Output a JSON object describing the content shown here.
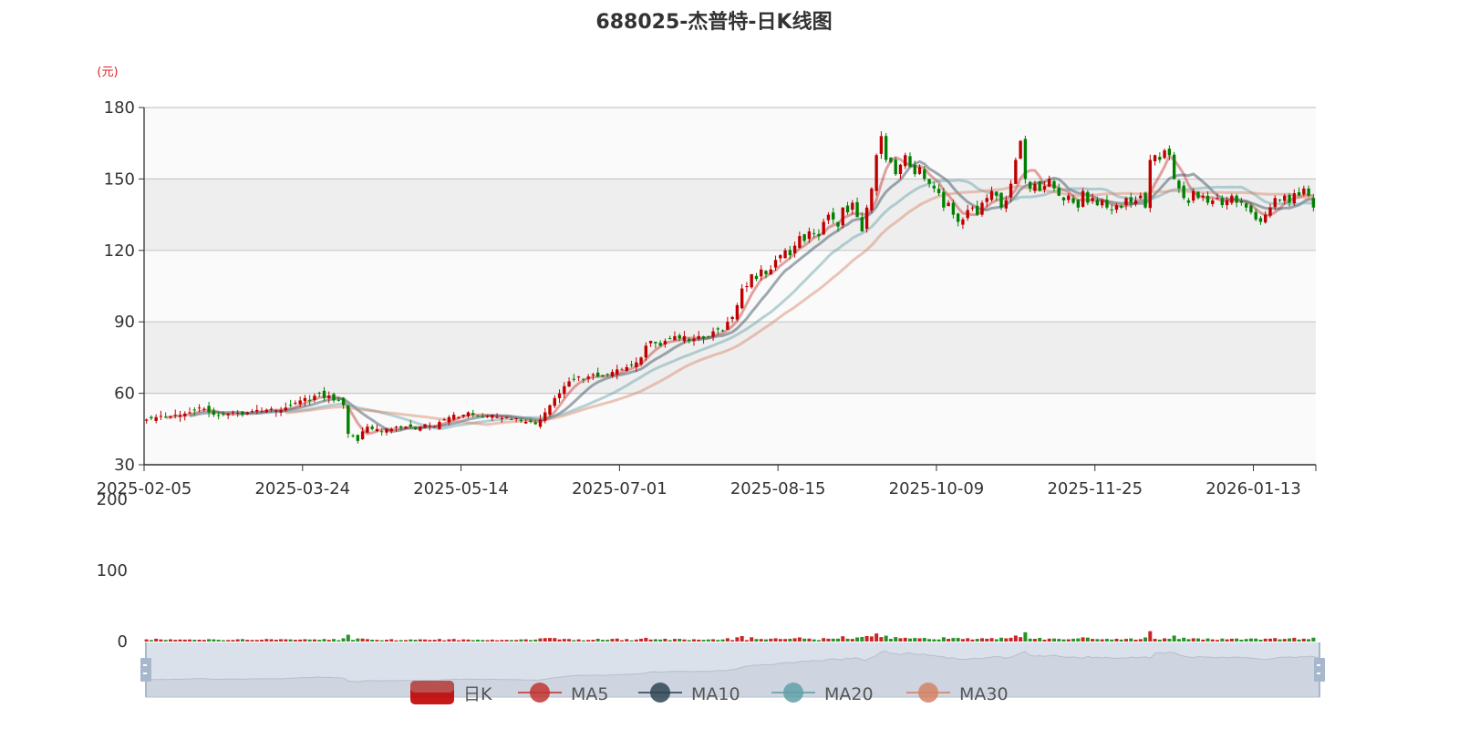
{
  "chart_data": {
    "type": "candlestick",
    "title": "688025-杰普特-日K线图",
    "ylabel": "(元)",
    "ylim": [
      30,
      180
    ],
    "yticks": [
      "30",
      "60",
      "90",
      "120",
      "150",
      "180"
    ],
    "xticks": [
      "2025-02-05",
      "2025-03-24",
      "2025-05-14",
      "2025-07-01",
      "2025-08-15",
      "2025-10-09",
      "2025-11-25",
      "2026-01-13"
    ],
    "xtick_interval": 33,
    "grid": true,
    "up_color": "#c00000",
    "down_color": "#008000",
    "close": [
      49,
      49.5,
      50,
      50.5,
      50,
      50.3,
      51,
      50.8,
      51.5,
      52,
      53,
      54,
      53.5,
      52,
      51,
      50.5,
      51,
      51.5,
      52,
      51.8,
      51,
      52,
      52.5,
      53,
      52.5,
      53,
      53.5,
      52.8,
      53,
      54,
      55,
      56,
      57,
      58,
      57,
      59,
      60,
      58,
      59,
      57,
      57,
      55,
      43,
      42,
      40,
      44,
      46,
      45,
      45,
      44,
      45,
      45,
      46,
      45.5,
      46,
      46,
      45,
      46,
      47,
      46.5,
      46,
      48,
      49,
      50,
      51,
      50,
      51,
      52,
      51,
      50.5,
      50,
      50.5,
      51,
      50,
      49.5,
      50,
      49,
      49.5,
      48.5,
      48,
      48,
      47,
      49,
      52,
      55,
      58,
      60,
      63,
      65,
      66,
      67,
      66,
      67,
      68,
      67,
      67,
      68,
      69,
      70,
      70,
      71,
      72,
      73,
      75,
      80,
      82,
      81,
      80,
      82,
      83,
      84,
      83,
      84,
      82,
      83,
      84,
      83,
      84,
      86,
      87,
      86,
      90,
      92,
      97,
      104,
      105,
      110,
      108,
      112,
      110,
      112,
      116,
      118,
      120,
      118,
      122,
      126,
      124,
      128,
      127,
      126,
      132,
      135,
      133,
      130,
      138,
      136,
      140,
      134,
      128,
      138,
      146,
      160,
      168,
      158,
      157,
      152,
      156,
      160,
      155,
      152,
      155,
      150,
      148,
      146,
      144,
      138,
      140,
      135,
      132,
      133,
      137,
      138,
      135,
      140,
      142,
      145,
      143,
      138,
      141,
      148,
      158,
      166,
      150,
      146,
      148,
      145,
      147,
      150,
      146,
      143,
      141,
      143,
      140,
      138,
      145,
      140,
      142,
      139,
      141,
      138,
      137,
      139,
      138,
      142,
      140,
      141,
      143,
      138,
      158,
      160,
      158,
      162,
      160,
      150,
      146,
      142,
      140,
      145,
      142,
      143,
      140,
      141,
      142,
      139,
      141,
      143,
      140,
      140,
      138,
      136,
      133,
      132,
      135,
      138,
      142,
      141,
      143,
      140,
      144,
      143,
      146,
      143,
      138
    ],
    "volume_axis": {
      "ylim": [
        0,
        200
      ],
      "yticks": [
        "0",
        "100",
        "200"
      ]
    },
    "legend": [
      {
        "name": "日K",
        "color": "#c00000",
        "type": "candle"
      },
      {
        "name": "MA5",
        "color": "#c23531",
        "period": 5
      },
      {
        "name": "MA10",
        "color": "#2f4554",
        "period": 10
      },
      {
        "name": "MA20",
        "color": "#61a0a8",
        "period": 20
      },
      {
        "name": "MA30",
        "color": "#d48265",
        "period": 30
      }
    ],
    "legend_position": "bottom-center"
  }
}
